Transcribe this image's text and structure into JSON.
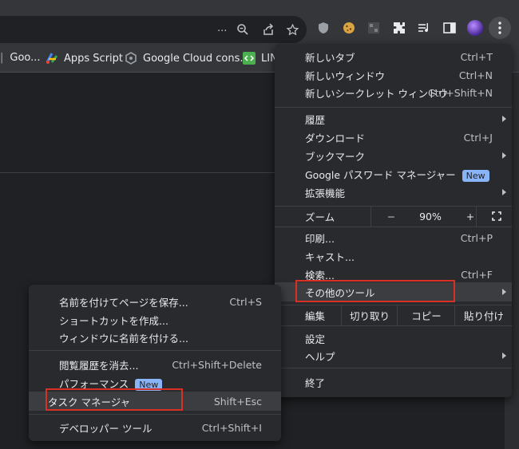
{
  "toolbar": {
    "omnibox_ellipsis": "...",
    "icons": [
      "zoom-icon",
      "share-icon",
      "star-icon",
      "shield-icon",
      "cookie-icon",
      "extension-box-icon",
      "puzzle-icon",
      "media-icon",
      "sidepanel-icon",
      "profile-icon",
      "more-vert-icon"
    ]
  },
  "bookmarks": [
    {
      "label": "Goo..."
    },
    {
      "label": "Apps Script"
    },
    {
      "label": "Google Cloud cons..."
    },
    {
      "label": "LIN"
    }
  ],
  "main_menu": {
    "new_tab": {
      "label": "新しいタブ",
      "shortcut": "Ctrl+T"
    },
    "new_window": {
      "label": "新しいウィンドウ",
      "shortcut": "Ctrl+N"
    },
    "incognito": {
      "label": "新しいシークレット ウィンドウ",
      "shortcut": "Ctrl+Shift+N"
    },
    "history": {
      "label": "履歴"
    },
    "downloads": {
      "label": "ダウンロード",
      "shortcut": "Ctrl+J"
    },
    "bookmarks": {
      "label": "ブックマーク"
    },
    "password_manager": {
      "label": "Google パスワード マネージャー",
      "badge": "New"
    },
    "extensions": {
      "label": "拡張機能"
    },
    "zoom": {
      "label": "ズーム",
      "minus": "−",
      "value": "90%",
      "plus": "+"
    },
    "print": {
      "label": "印刷...",
      "shortcut": "Ctrl+P"
    },
    "cast": {
      "label": "キャスト..."
    },
    "find": {
      "label": "検索...",
      "shortcut": "Ctrl+F"
    },
    "more_tools": {
      "label": "その他のツール"
    },
    "edit": {
      "label": "編集",
      "cut": "切り取り",
      "copy": "コピー",
      "paste": "貼り付け"
    },
    "settings": {
      "label": "設定"
    },
    "help": {
      "label": "ヘルプ"
    },
    "exit": {
      "label": "終了"
    }
  },
  "submenu": {
    "save_page": {
      "label": "名前を付けてページを保存...",
      "shortcut": "Ctrl+S"
    },
    "create_shortcut": {
      "label": "ショートカットを作成..."
    },
    "name_window": {
      "label": "ウィンドウに名前を付ける..."
    },
    "clear_data": {
      "label": "閲覧履歴を消去...",
      "shortcut": "Ctrl+Shift+Delete"
    },
    "performance": {
      "label": "パフォーマンス",
      "badge": "New"
    },
    "task_manager": {
      "label": "タスク マネージャ",
      "shortcut": "Shift+Esc"
    },
    "devtools": {
      "label": "デベロッパー ツール",
      "shortcut": "Ctrl+Shift+I"
    }
  },
  "colors": {
    "highlight_box": "#d93025",
    "badge": "#8ab4f8"
  }
}
